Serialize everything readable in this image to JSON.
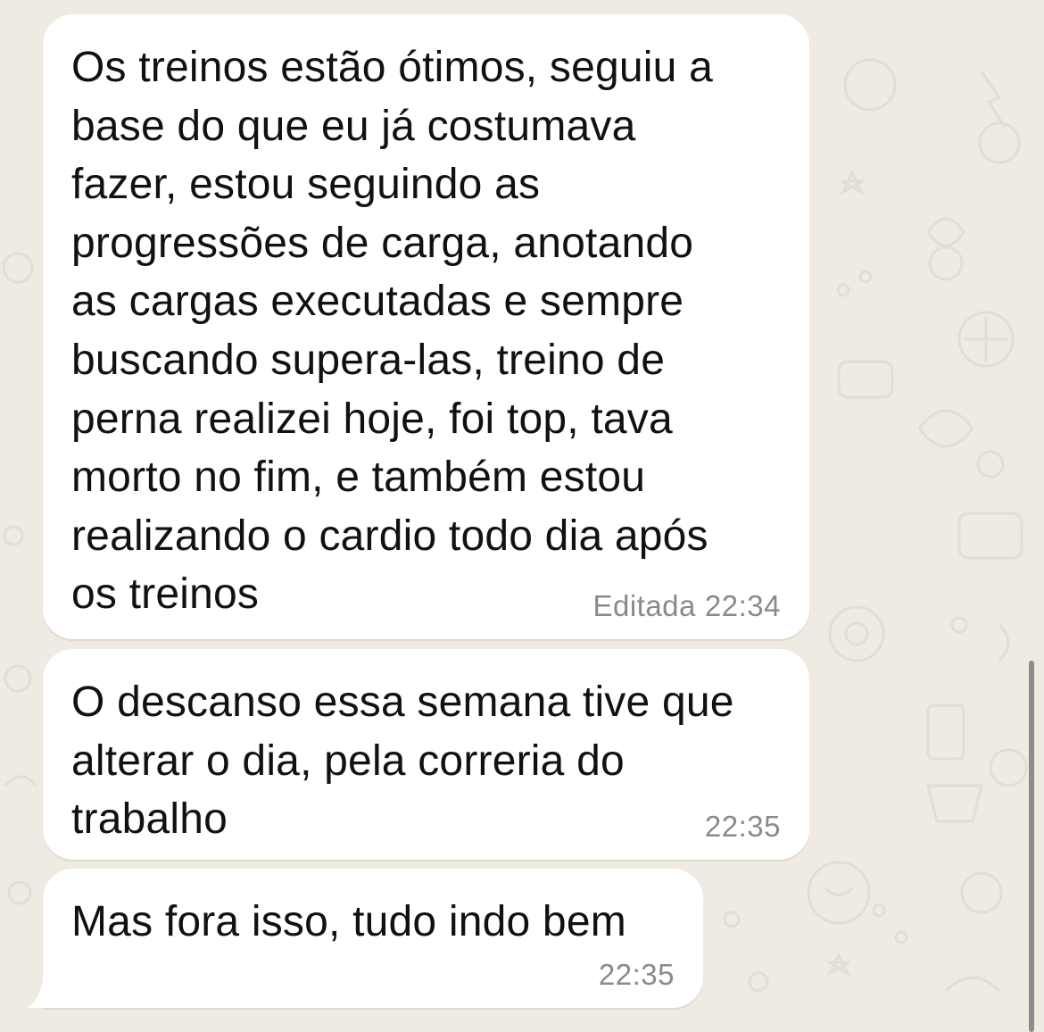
{
  "chat": {
    "messages": [
      {
        "text": "Os treinos estão ótimos, seguiu a\nbase do que eu já costumava\nfazer, estou seguindo as\nprogressões de carga, anotando\nas cargas executadas e sempre\nbuscando supera-las, treino de\nperna realizei hoje, foi top, tava\nmorto no fim, e também estou\nrealizando o cardio todo dia após\nos treinos",
        "edited_label": "Editada",
        "time": "22:34"
      },
      {
        "text": "O descanso essa semana tive que\nalterar o dia, pela correria do\ntrabalho",
        "time": "22:35"
      },
      {
        "text": "Mas fora isso, tudo indo bem",
        "time": "22:35"
      }
    ]
  },
  "colors": {
    "background": "#efeae2",
    "bubble": "#ffffff",
    "text": "#111111",
    "meta": "#8a8a8a"
  }
}
